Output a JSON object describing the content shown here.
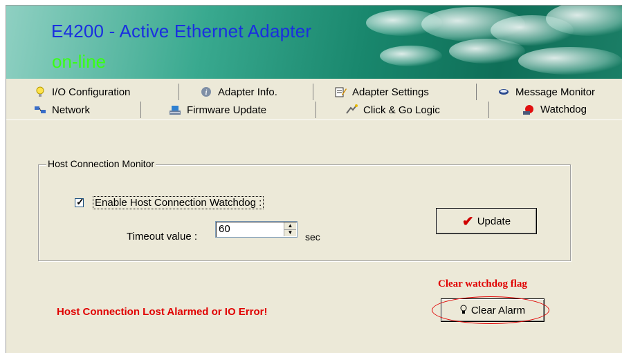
{
  "banner": {
    "title": "E4200 - Active Ethernet Adapter",
    "status": "on-line"
  },
  "tabs_row1": [
    {
      "label": "I/O Configuration",
      "icon": "lightbulb-icon"
    },
    {
      "label": "Adapter Info.",
      "icon": "info-icon"
    },
    {
      "label": "Adapter Settings",
      "icon": "settings-icon"
    },
    {
      "label": "Message Monitor",
      "icon": "monitor-icon"
    }
  ],
  "tabs_row2": [
    {
      "label": "Network",
      "icon": "network-icon"
    },
    {
      "label": "Firmware Update",
      "icon": "firmware-icon"
    },
    {
      "label": "Click & Go Logic",
      "icon": "logic-icon"
    },
    {
      "label": "Watchdog",
      "icon": "watchdog-icon",
      "active": true
    }
  ],
  "watchdog": {
    "group_title": "Host Connection Monitor",
    "enable_label": "Enable Host Connection Watchdog :",
    "enable_checked": true,
    "timeout_label": "Timeout value :",
    "timeout_value": "60",
    "timeout_unit": "sec",
    "update_label": "Update",
    "clear_note": "Clear watchdog flag",
    "clear_label": "Clear Alarm",
    "alarm_message": "Host Connection Lost Alarmed or IO Error!"
  },
  "colors": {
    "alarm_red": "#e00000",
    "title_blue": "#1a2fe0",
    "status_green": "#39ff14"
  }
}
